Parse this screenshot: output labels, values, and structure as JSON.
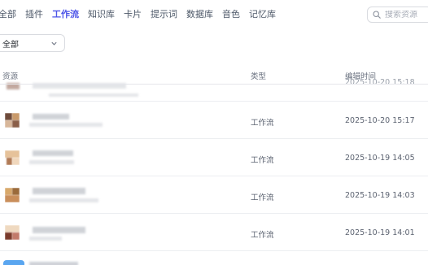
{
  "tabs": [
    {
      "label": "全部",
      "active": false
    },
    {
      "label": "插件",
      "active": false
    },
    {
      "label": "工作流",
      "active": true
    },
    {
      "label": "知识库",
      "active": false
    },
    {
      "label": "卡片",
      "active": false
    },
    {
      "label": "提示词",
      "active": false
    },
    {
      "label": "数据库",
      "active": false
    },
    {
      "label": "音色",
      "active": false
    },
    {
      "label": "记忆库",
      "active": false
    }
  ],
  "search": {
    "placeholder": "搜索资源",
    "value": ""
  },
  "filter": {
    "selected": "全部"
  },
  "table": {
    "headers": {
      "resource": "资源",
      "type": "类型",
      "edit_time": "编辑时间"
    },
    "partial_top_time": "2025-10-20 15:18",
    "rows": [
      {
        "type": "工作流",
        "edit_time": "2025-10-20 15:17"
      },
      {
        "type": "工作流",
        "edit_time": "2025-10-19 14:05"
      },
      {
        "type": "工作流",
        "edit_time": "2025-10-19 14:03"
      },
      {
        "type": "工作流",
        "edit_time": "2025-10-19 14:01"
      }
    ]
  },
  "colors": {
    "active_tab": "#4e56e8",
    "text_secondary": "#5b6270",
    "border": "#d9dbe0"
  },
  "icons": {
    "search": "search-icon",
    "dropdown": "chevron-down-icon"
  }
}
